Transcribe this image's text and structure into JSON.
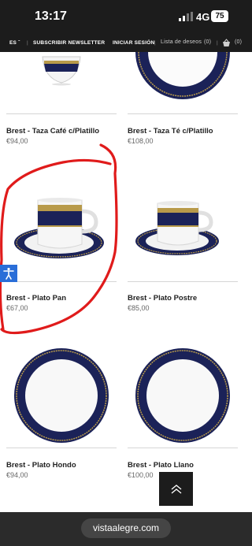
{
  "status_bar": {
    "time": "13:17",
    "network": "4G",
    "battery": "75"
  },
  "nav": {
    "language": "ES",
    "newsletter": "SUBSCRIBIR NEWSLETTER",
    "login": "INICIAR SESIÓN",
    "wishlist": "Lista de deseos",
    "wishlist_count": "(0)",
    "cart_count": "(0)"
  },
  "products": [
    {
      "name": "Brest - Taza Café c/Platillo",
      "price": "€94,00"
    },
    {
      "name": "Brest - Taza Té c/Platillo",
      "price": "€108,00"
    },
    {
      "name": "Brest - Plato Pan",
      "price": "€67,00"
    },
    {
      "name": "Brest - Plato Postre",
      "price": "€85,00"
    },
    {
      "name": "Brest - Plato Hondo",
      "price": "€94,00"
    },
    {
      "name": "Brest - Plato Llano",
      "price": "€100,00"
    }
  ],
  "browser": {
    "url": "vistaalegre.com"
  },
  "colors": {
    "navy": "#1b2258",
    "gold": "#b89a4a",
    "annotation_red": "#e01b1b",
    "accessibility_blue": "#2a6ed8"
  }
}
